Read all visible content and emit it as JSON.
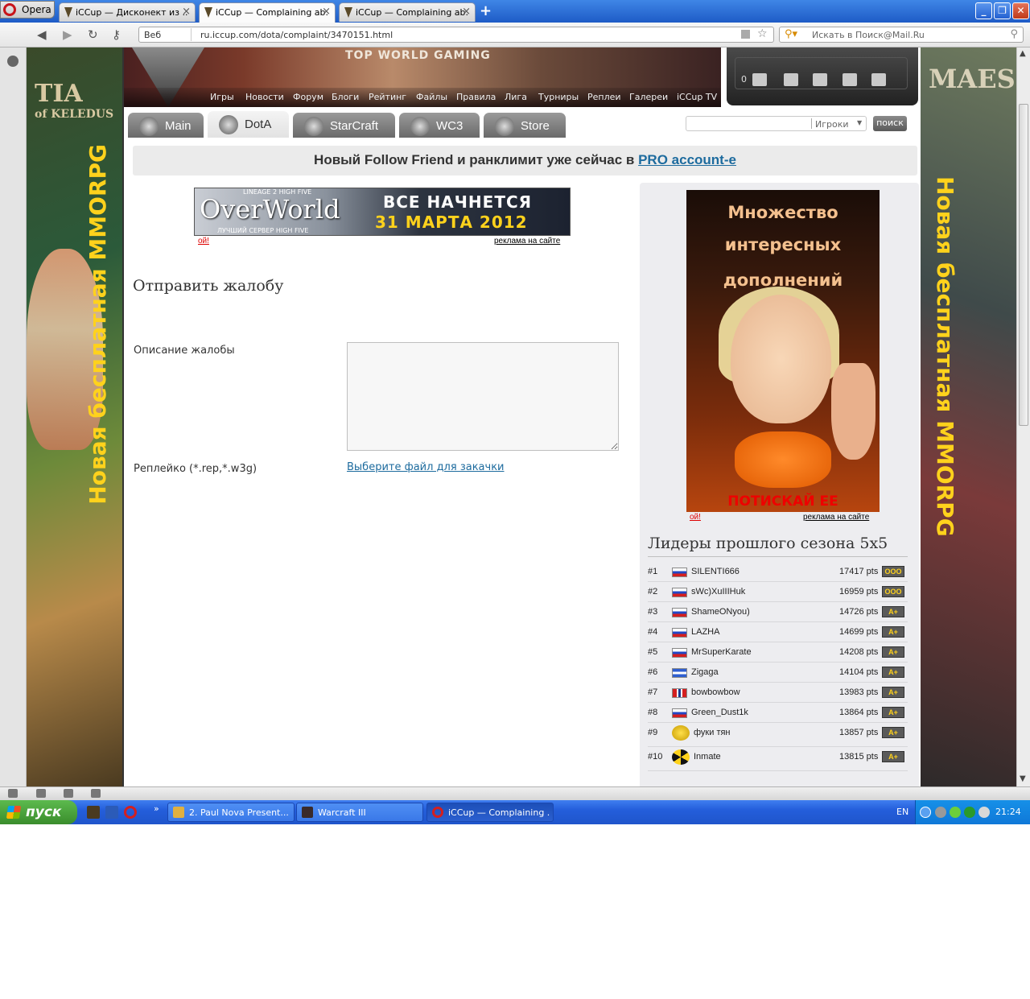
{
  "browser": {
    "menu_label": "Opera",
    "tabs": [
      {
        "title": "iCCup — Дисконект из ...",
        "active": false
      },
      {
        "title": "iCCup — Complaining ab...",
        "active": true
      },
      {
        "title": "iCCup — Complaining ab...",
        "active": false
      }
    ],
    "new_tab": "+",
    "address": {
      "web_label": "Веб",
      "url": "ru.iccup.com/dota/complaint/3470151.html"
    },
    "search_placeholder": "Искать в Поиск@Mail.Ru"
  },
  "ads": {
    "left_logo": "TIA",
    "left_logo_sub": "of KELEDUS",
    "left_vertical": "Новая бесплатная MMORPG",
    "right_logo": "MAES",
    "right_vertical": "Новая бесплатная MMORPG"
  },
  "site": {
    "slogan": "TOP WORLD GAMING",
    "nav": [
      "Игры",
      "Новости",
      "Форум",
      "Блоги",
      "Рейтинг",
      "Файлы",
      "Правила",
      "Лига",
      "Турниры",
      "Реплеи",
      "Галереи",
      "iCCup TV"
    ],
    "messages_count": "0",
    "search_placeholder": "",
    "search_scope": "Игроки",
    "search_button": "поиск",
    "game_tabs": [
      {
        "label": "Main",
        "active": false
      },
      {
        "label": "DotA",
        "active": true
      },
      {
        "label": "StarCraft",
        "active": false
      },
      {
        "label": "WC3",
        "active": false
      },
      {
        "label": "Store",
        "active": false
      }
    ],
    "promo_text": "Новый Follow Friend и ранклимит уже сейчас в ",
    "promo_link": "PRO account-e"
  },
  "banner_top": {
    "tag": "LINEAGE 2 HIGH FIVE",
    "brand": "OverWorld",
    "sub": "ЛУЧШИЙ СЕРВЕР HIGH FIVE",
    "line1": "ВСЕ НАЧНЕТСЯ",
    "line2": "31 МАРТА 2012",
    "oi": "ой!",
    "ad_link": "реклама на сайте"
  },
  "form": {
    "title": "Отправить жалобу",
    "description_label": "Описание жалобы",
    "description_value": "",
    "replay_label": "Реплейко (*.rep,*.w3g)",
    "file_link": "Выберите файл для закачки"
  },
  "side_ad": {
    "line1": "Множество",
    "line2": "интересных",
    "line3": "дополнений",
    "cta": "ПОТИСКАЙ ЕЕ",
    "oi": "ой!",
    "ad_link": "реклама на сайте"
  },
  "leaders": {
    "title": "Лидеры прошлого сезона 5x5",
    "rows": [
      {
        "rank": "#1",
        "name": "SILENTI666",
        "pts": "17417 pts",
        "badge": "OOO"
      },
      {
        "rank": "#2",
        "name": "sWc)XuIIIHuk",
        "pts": "16959 pts",
        "badge": "OOO"
      },
      {
        "rank": "#3",
        "name": "ShameONyou)",
        "pts": "14726 pts",
        "badge": "A+"
      },
      {
        "rank": "#4",
        "name": "LAZHA",
        "pts": "14699 pts",
        "badge": "A+"
      },
      {
        "rank": "#5",
        "name": "MrSuperKarate",
        "pts": "14208 pts",
        "badge": "A+"
      },
      {
        "rank": "#6",
        "name": "Zigaga",
        "pts": "14104 pts",
        "badge": "A+"
      },
      {
        "rank": "#7",
        "name": "bowbowbow",
        "pts": "13983 pts",
        "badge": "A+"
      },
      {
        "rank": "#8",
        "name": "Green_Dust1k",
        "pts": "13864 pts",
        "badge": "A+"
      },
      {
        "rank": "#9",
        "name": "фуки тян",
        "pts": "13857 pts",
        "badge": "A+"
      },
      {
        "rank": "#10",
        "name": "Inmate",
        "pts": "13815 pts",
        "badge": "A+"
      }
    ]
  },
  "taskbar": {
    "start": "пуск",
    "buttons": [
      {
        "title": "2. Paul Nova Present...",
        "active": false
      },
      {
        "title": "Warcraft III",
        "active": false
      },
      {
        "title": "iCCup — Complaining ...",
        "active": true
      }
    ],
    "lang": "EN",
    "clock": "21:24"
  }
}
